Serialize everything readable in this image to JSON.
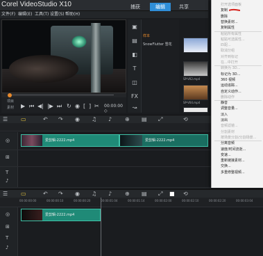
{
  "app": {
    "title": "Corel VideoStudio X10",
    "menu": [
      "文件(F)",
      "编辑(E)",
      "工具(T)",
      "设置(S)",
      "帮助(H)"
    ],
    "tabs": [
      "捕获",
      "编辑",
      "共享"
    ],
    "active_tab": "编辑",
    "accent_color": "#2f8ed8",
    "clip_color": "#1f8a77"
  },
  "preview": {
    "mode_labels": [
      "项目",
      "素材"
    ],
    "timecode": "00:00:00 ◇"
  },
  "library": {
    "list_items": [
      "样本",
      "SnowFlutter 雪花"
    ],
    "thumbs": [
      {
        "caption": ""
      },
      {
        "caption": "SP-V02.mp4"
      },
      {
        "caption": "SP-V04.mp4"
      },
      {
        "caption": ""
      }
    ]
  },
  "context_menu": {
    "items": [
      {
        "label": "打开选项面板",
        "enabled": false
      },
      {
        "label": "复制",
        "enabled": true
      },
      {
        "label": "删除",
        "enabled": true
      },
      {
        "label": "替换素材...",
        "enabled": true
      },
      {
        "label": "复制属性",
        "enabled": true
      },
      {
        "label": "粘贴所有属性",
        "enabled": false
      },
      {
        "label": "粘贴可选属性...",
        "enabled": false
      },
      {
        "label": "匹配...",
        "enabled": false
      },
      {
        "label": "取消分组",
        "enabled": false
      },
      {
        "label": "对齐到标记",
        "enabled": false
      },
      {
        "label": "在...中打开",
        "enabled": false
      },
      {
        "label": "转换为 3D...",
        "enabled": false
      },
      {
        "label": "标记为 3D...",
        "enabled": true
      },
      {
        "label": "360 视频",
        "enabled": true
      },
      {
        "label": "运动追踪...",
        "enabled": true
      },
      {
        "label": "自定义动作...",
        "enabled": true
      },
      {
        "label": "删除动作",
        "enabled": false
      },
      {
        "label": "静音",
        "enabled": true
      },
      {
        "label": "调整音量...",
        "enabled": true
      },
      {
        "label": "淡入",
        "enabled": true
      },
      {
        "label": "淡出",
        "enabled": true
      },
      {
        "label": "音频滤镜...",
        "enabled": false
      },
      {
        "label": "分割素材",
        "enabled": false
      },
      {
        "label": "按场景分割/分割场景...",
        "enabled": false
      },
      {
        "label": "分离音频",
        "enabled": true
      },
      {
        "label": "速度/时间流逝...",
        "enabled": true
      },
      {
        "label": "变速...",
        "enabled": true
      },
      {
        "label": "重新链接素材...",
        "enabled": true
      },
      {
        "label": "交换...",
        "enabled": true
      },
      {
        "label": "多重修整视频...",
        "enabled": true
      }
    ]
  },
  "timeline": {
    "upper": {
      "clip1_label": "爱剪辑-2222.mp4",
      "clip2_label": "爱剪辑-2222.mp4"
    },
    "lower": {
      "clip_label": "爱剪辑-2222.mp4",
      "ruler_labels": [
        "00:00:00:00",
        "00:00:00:10",
        "00:00:00:20",
        "00:00:01:04",
        "00:00:01:14",
        "00:00:02:00",
        "00:00:02:10",
        "00:00:02:20",
        "00:00:03:04"
      ]
    }
  }
}
